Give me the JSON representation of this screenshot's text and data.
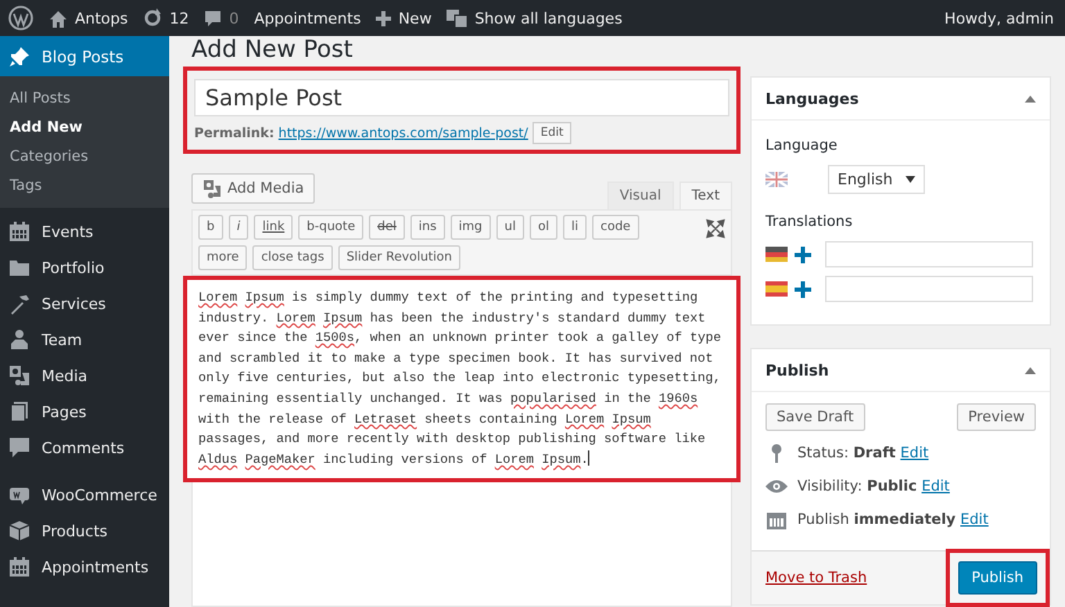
{
  "admin_bar": {
    "site": "Antops",
    "updates": "12",
    "comments": "0",
    "items": [
      "Appointments",
      "New",
      "Show all languages"
    ],
    "greeting": "Howdy, admin"
  },
  "sidebar": {
    "items": [
      {
        "label": "Blog Posts",
        "selected": true,
        "children": [
          {
            "label": "All Posts",
            "selected": false
          },
          {
            "label": "Add New",
            "selected": true
          },
          {
            "label": "Categories",
            "selected": false
          },
          {
            "label": "Tags",
            "selected": false
          }
        ]
      },
      {
        "label": "Events",
        "selected": false
      },
      {
        "label": "Portfolio",
        "selected": false
      },
      {
        "label": "Services",
        "selected": false
      },
      {
        "label": "Team",
        "selected": false
      },
      {
        "label": "Media",
        "selected": false
      },
      {
        "label": "Pages",
        "selected": false
      },
      {
        "label": "Comments",
        "selected": false
      },
      {
        "label": "WooCommerce",
        "selected": false,
        "group_start": true
      },
      {
        "label": "Products",
        "selected": false
      },
      {
        "label": "Appointments",
        "selected": false
      }
    ]
  },
  "page_title": "Add New Post",
  "post_title": {
    "value": "Sample Post"
  },
  "permalink": {
    "label": "Permalink:",
    "url": "https://www.antops.com/sample-post/",
    "edit": "Edit"
  },
  "add_media": "Add Media",
  "editor_tabs": [
    {
      "label": "Visual",
      "selected": false
    },
    {
      "label": "Text",
      "selected": true
    }
  ],
  "quicktags": [
    {
      "label": "b",
      "kind": "plain"
    },
    {
      "label": "i",
      "kind": "italic"
    },
    {
      "label": "link",
      "kind": "link"
    },
    {
      "label": "b-quote",
      "kind": "plain"
    },
    {
      "label": "del",
      "kind": "strike"
    },
    {
      "label": "ins",
      "kind": "plain"
    },
    {
      "label": "img",
      "kind": "plain"
    },
    {
      "label": "ul",
      "kind": "plain"
    },
    {
      "label": "ol",
      "kind": "plain"
    },
    {
      "label": "li",
      "kind": "plain"
    },
    {
      "label": "code",
      "kind": "plain"
    },
    {
      "label": "more",
      "kind": "plain"
    },
    {
      "label": "close tags",
      "kind": "plain"
    },
    {
      "label": "Slider Revolution",
      "kind": "plain"
    }
  ],
  "content": [
    {
      "text": "Lorem Ipsum",
      "flagged": true
    },
    {
      "text": " is simply dummy text of the printing and typesetting\nindustry. ",
      "flagged": false
    },
    {
      "text": "Lorem Ipsum",
      "flagged": true
    },
    {
      "text": " has been the industry's standard dummy text\never since the ",
      "flagged": false
    },
    {
      "text": "1500s",
      "flagged": true
    },
    {
      "text": ", when an unknown printer took a galley of type\nand scrambled it to make a type specimen book. It has survived not\nonly five centuries, but also the leap into electronic typesetting,\nremaining essentially unchanged. It was ",
      "flagged": false
    },
    {
      "text": "popularised",
      "flagged": true
    },
    {
      "text": " in the ",
      "flagged": false
    },
    {
      "text": "1960s",
      "flagged": true
    },
    {
      "text": "\nwith the release of ",
      "flagged": false
    },
    {
      "text": "Letraset",
      "flagged": true
    },
    {
      "text": " sheets containing ",
      "flagged": false
    },
    {
      "text": "Lorem Ipsum",
      "flagged": true
    },
    {
      "text": "\npassages, and more recently with desktop publishing software like\n",
      "flagged": false
    },
    {
      "text": "Aldus PageMaker",
      "flagged": true
    },
    {
      "text": " including versions of ",
      "flagged": false
    },
    {
      "text": "Lorem Ipsum",
      "flagged": true
    },
    {
      "text": ".",
      "flagged": false
    }
  ],
  "languages_box": {
    "title": "Languages",
    "language_label": "Language",
    "language": "English",
    "translations_label": "Translations",
    "translations": [
      {
        "kind": "de"
      },
      {
        "kind": "es"
      }
    ]
  },
  "publish_box": {
    "title": "Publish",
    "save_draft": "Save Draft",
    "preview": "Preview",
    "rows": [
      {
        "kind": "status",
        "text": "Status: **Draft**",
        "link": "Edit"
      },
      {
        "kind": "visibility",
        "text": "Visibility: **Public**",
        "link": "Edit"
      },
      {
        "kind": "schedule",
        "text": "Publish **immediately**",
        "link": "Edit"
      }
    ],
    "trash": "Move to Trash",
    "publish": "Publish"
  }
}
